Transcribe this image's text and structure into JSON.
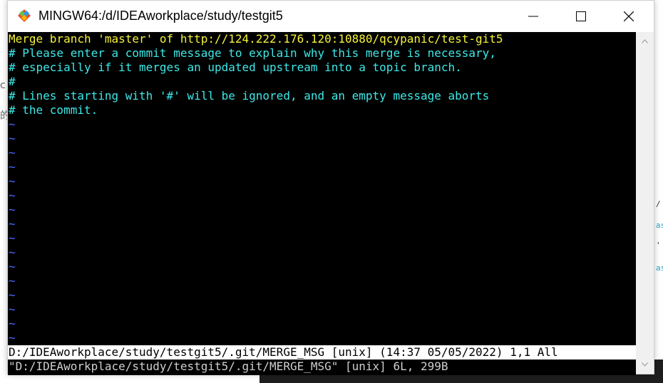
{
  "window": {
    "title": "MINGW64:/d/IDEAworkplace/study/testgit5",
    "controls": [
      "minimize-icon",
      "maximize-icon",
      "close-icon"
    ]
  },
  "editor": {
    "lines": [
      {
        "text": "Merge branch 'master' of http://124.222.176.120:10880/qcypanic/test-git5",
        "color": "#f6f33a"
      },
      {
        "text": "# Please enter a commit message to explain why this merge is necessary,",
        "color": "#3ee8e8"
      },
      {
        "text": "# especially if it merges an updated upstream into a topic branch.",
        "color": "#3ee8e8"
      },
      {
        "text": "#",
        "color": "#3ee8e8"
      },
      {
        "text": "# Lines starting with '#' will be ignored, and an empty message aborts",
        "color": "#3ee8e8"
      },
      {
        "text": "# the commit.",
        "color": "#3ee8e8"
      }
    ],
    "tilde": "~",
    "tilde_count": 16,
    "status_line": "D:/IDEAworkplace/study/testgit5/.git/MERGE_MSG [unix] (14:37 05/05/2022) 1,1 All",
    "message_line": "\"D:/IDEAworkplace/study/testgit5/.git/MERGE_MSG\" [unix] 6L, 299B"
  },
  "colors": {
    "background": "#000000",
    "first_line": "#f6f33a",
    "comment": "#3ee8e8",
    "tilde": "#4a6cff"
  }
}
